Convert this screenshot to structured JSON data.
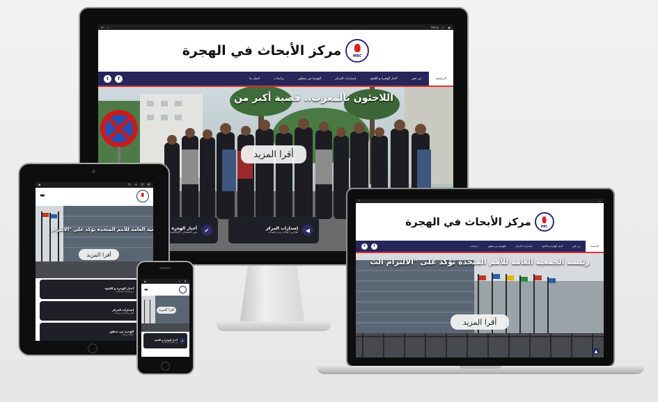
{
  "site": {
    "logo_text": "مركز الأبحاث  في الهجرة",
    "logo_badge": "MRC",
    "read_more": "أقرا المزيد",
    "toolbar_menu_label": "Menu"
  },
  "desktop": {
    "nav_items": [
      "الرئيسية",
      "من نحن",
      "أخبار الهجرة و اللجوء",
      "إصدارات المركز",
      "الهجرة من منظور",
      "دراسات",
      "اتصل بنا"
    ],
    "hero_title": "اللاجئون بالمغرب.. قضية أكبر من",
    "cards": [
      {
        "title": "أخبار الهجرة و اللجوء",
        "sub": "من المصادر الإعلامية",
        "icon": "check-icon"
      },
      {
        "title": "إصدارات المركز",
        "sub": "تقارير أبحاث و دراسات",
        "icon": "megaphone-icon"
      }
    ]
  },
  "laptop": {
    "nav_items": [
      "الرئيسية",
      "من نحن",
      "أخبار الهجرة و اللجوء",
      "إصدارات المركز",
      "الهجرة من منظور",
      "دراسات",
      "اتصل بنا"
    ],
    "hero_title": "رئيسة الجمعية العامة للأمم المتحدة تؤكد على \"الالتزام الث"
  },
  "tablet": {
    "hero_title": "رئيسة الجمعية العامة للأمم المتحدة تؤكد على \"الالتزام",
    "cards": [
      {
        "title": "أخبار الهجرة و اللجوء",
        "sub": "من المصادر الإعلامية"
      },
      {
        "title": "إصدارات المركز",
        "sub": "تقارير أبحاث و دراسات"
      },
      {
        "title": "الهجرة من منظور",
        "sub": "مقالات و آراء"
      }
    ]
  },
  "phone": {
    "read_more": "أقرا المزيد",
    "card_title": "أخبار الهجرة و اللجوء",
    "card_sub": "من المصادر الإعلامية"
  },
  "colors": {
    "navy": "#26265a",
    "accent_red": "#d83030",
    "card_dark": "#1f1f27",
    "toolbar": "#1e1e1e"
  }
}
